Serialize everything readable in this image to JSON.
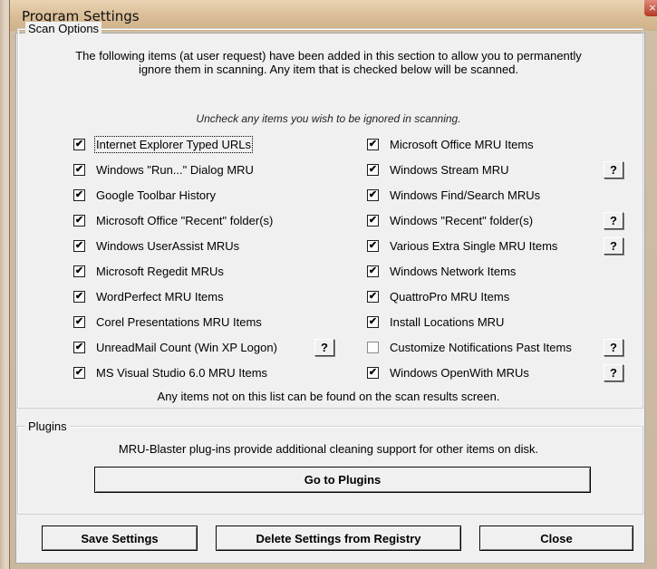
{
  "window": {
    "title": "Program Settings"
  },
  "scan_options": {
    "legend": "Scan Options",
    "intro_line1": "The following items (at user request) have been added in this section to allow you to permanently",
    "intro_line2": "ignore them in scanning. Any item that is checked below will be scanned.",
    "hint": "Uncheck any items you wish to be ignored in scanning.",
    "left_items": [
      {
        "label": "Internet Explorer Typed URLs",
        "checked": true
      },
      {
        "label": "Windows \"Run...\" Dialog MRU",
        "checked": true
      },
      {
        "label": "Google Toolbar History",
        "checked": true
      },
      {
        "label": "Microsoft Office \"Recent\" folder(s)",
        "checked": true
      },
      {
        "label": "Windows UserAssist MRUs",
        "checked": true
      },
      {
        "label": "Microsoft Regedit MRUs",
        "checked": true
      },
      {
        "label": "WordPerfect MRU Items",
        "checked": true
      },
      {
        "label": "Corel Presentations MRU Items",
        "checked": true
      },
      {
        "label": "UnreadMail Count (Win XP Logon)",
        "checked": true
      },
      {
        "label": "MS Visual Studio 6.0 MRU Items",
        "checked": true
      }
    ],
    "right_items": [
      {
        "label": "Microsoft Office MRU Items",
        "checked": true
      },
      {
        "label": "Windows Stream MRU",
        "checked": true
      },
      {
        "label": "Windows Find/Search MRUs",
        "checked": true
      },
      {
        "label": "Windows \"Recent\" folder(s)",
        "checked": true
      },
      {
        "label": "Various Extra Single MRU Items",
        "checked": true
      },
      {
        "label": "Windows Network Items",
        "checked": true
      },
      {
        "label": "QuattroPro MRU Items",
        "checked": true
      },
      {
        "label": "Install Locations MRU",
        "checked": true
      },
      {
        "label": "Customize Notifications Past Items",
        "checked": false
      },
      {
        "label": "Windows OpenWith MRUs",
        "checked": true
      }
    ],
    "help_label": "?",
    "footer_note": "Any items not on this list can be found on the scan results screen."
  },
  "plugins": {
    "legend": "Plugins",
    "description": "MRU-Blaster plug-ins provide additional cleaning support for other items on disk.",
    "button_label": "Go to Plugins"
  },
  "buttons": {
    "save": "Save Settings",
    "delete": "Delete Settings from Registry",
    "close": "Close"
  },
  "check_mark": "✔"
}
